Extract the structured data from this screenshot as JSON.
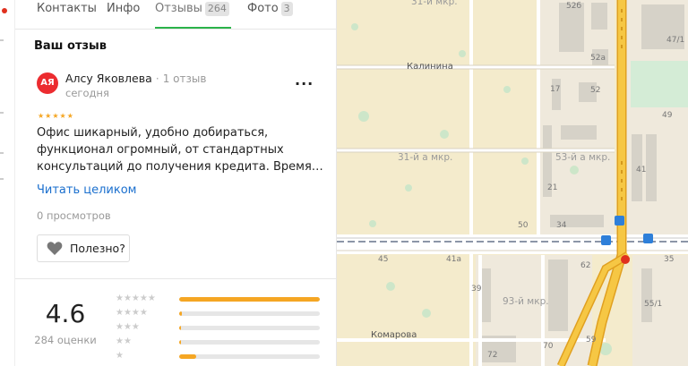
{
  "tabs": [
    {
      "label": "Контакты"
    },
    {
      "label": "Инфо"
    },
    {
      "label": "Отзывы",
      "count": "264"
    },
    {
      "label": "Фото",
      "count": "3"
    }
  ],
  "review": {
    "section_title": "Ваш отзыв",
    "avatar_initials": "АЯ",
    "author": "Алсу Яковлева",
    "author_reviews": "1 отзыв",
    "date": "сегодня",
    "more": "...",
    "stars": "★★★★★",
    "text_lines": [
      "Офис шикарный, удобно добираться,",
      "функционал огромный, от стандартных",
      "консультаций до получения кредита. Время…"
    ],
    "read_more": "Читать целиком",
    "views": "0 просмотров",
    "useful": "Полезно?"
  },
  "rating": {
    "score": "4.6",
    "count": "284 оценки",
    "rows": [
      {
        "stars": "★★★★★",
        "fraction": 1.0
      },
      {
        "stars": "★★★★",
        "fraction": 0.02
      },
      {
        "stars": "★★★",
        "fraction": 0.01
      },
      {
        "stars": "★★",
        "fraction": 0.01
      },
      {
        "stars": "★",
        "fraction": 0.12
      }
    ]
  },
  "map": {
    "streets": [
      "Калинина",
      "Комарова"
    ],
    "districts": [
      "31-й мкр.",
      "31-й а мкр.",
      "53-й а мкр.",
      "93-й мкр."
    ],
    "house_numbers": [
      "52б",
      "52а",
      "52",
      "17",
      "47/1",
      "49",
      "41",
      "21",
      "50",
      "34",
      "45",
      "41а",
      "62",
      "39",
      "35",
      "55/1",
      "70",
      "72",
      "59"
    ]
  },
  "colors": {
    "accent_green": "#2bb34a",
    "link_blue": "#1a6fce",
    "star_orange": "#f5a623",
    "avatar_red": "#ec2c30"
  }
}
